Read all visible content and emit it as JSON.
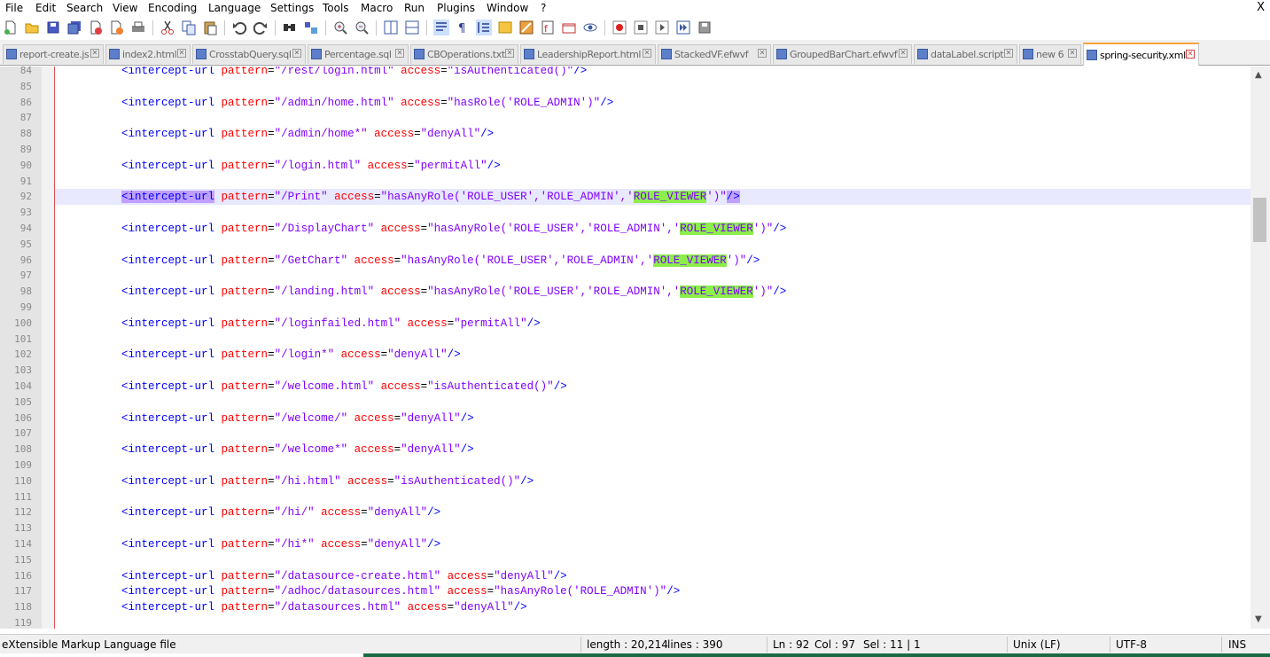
{
  "menu": [
    "File",
    "Edit",
    "Search",
    "View",
    "Encoding",
    "Language",
    "Settings",
    "Tools",
    "Macro",
    "Run",
    "Plugins",
    "Window",
    "?"
  ],
  "close_label": "X",
  "tabs": [
    {
      "label": "report-create.js"
    },
    {
      "label": "index2.html"
    },
    {
      "label": "CrosstabQuery.sql"
    },
    {
      "label": "Percentage.sql"
    },
    {
      "label": "CBOperations.txt"
    },
    {
      "label": "LeadershipReport.html"
    },
    {
      "label": "StackedVF.efwvf"
    },
    {
      "label": "GroupedBarChart.efwvf"
    },
    {
      "label": "dataLabel.script"
    },
    {
      "label": "new 6"
    },
    {
      "label": "spring-security.xml",
      "active": true
    }
  ],
  "tab_nav": {
    "left": "◂",
    "right": "▸"
  },
  "editor": {
    "line_numbers": [
      "84",
      "85",
      "86",
      "87",
      "88",
      "89",
      "90",
      "91",
      "92",
      "93",
      "94",
      "95",
      "96",
      "97",
      "98",
      "99",
      "100",
      "101",
      "102",
      "103",
      "104",
      "105",
      "106",
      "107",
      "108",
      "109",
      "110",
      "111",
      "112",
      "113",
      "114",
      "115",
      "116",
      "117",
      "118",
      "119"
    ],
    "current_line": "92",
    "lines": [
      {
        "n": "84",
        "pattern": "\"/rest/login.html\"",
        "access": "\"isAuthenticated()\"",
        "close": "/>"
      },
      {
        "n": "86",
        "pattern": "\"/admin/home.html\"",
        "access": "\"hasRole('ROLE_ADMIN')\"",
        "close": "/>"
      },
      {
        "n": "88",
        "pattern": "\"/admin/home*\"",
        "access": "\"denyAll\"",
        "close": "/>"
      },
      {
        "n": "90",
        "pattern": "\"/login.html\"",
        "access": "\"permitAll\"",
        "close": "/>"
      },
      {
        "n": "92",
        "pattern": "\"/Print\"",
        "access": "\"hasAnyRole('ROLE_USER','ROLE_ADMIN','",
        "mark": "ROLE_VIEWER",
        "access_end": "')\"",
        "close": "/>"
      },
      {
        "n": "94",
        "pattern": "\"/DisplayChart\"",
        "access": "\"hasAnyRole('ROLE_USER','ROLE_ADMIN','",
        "mark": "ROLE_VIEWER",
        "access_end": "')\"",
        "close": "/>"
      },
      {
        "n": "96",
        "pattern": "\"/GetChart\"",
        "access": "\"hasAnyRole('ROLE_USER','ROLE_ADMIN','",
        "mark": "ROLE_VIEWER",
        "access_end": "')\"",
        "close": "/>"
      },
      {
        "n": "98",
        "pattern": "\"/landing.html\"",
        "access": "\"hasAnyRole('ROLE_USER','ROLE_ADMIN','",
        "mark": "ROLE_VIEWER",
        "access_end": "')\"",
        "close": "/>"
      },
      {
        "n": "100",
        "pattern": "\"/loginfailed.html\"",
        "access": "\"permitAll\"",
        "close": "/>"
      },
      {
        "n": "102",
        "pattern": "\"/login*\"",
        "access": "\"denyAll\"",
        "close": "/>"
      },
      {
        "n": "104",
        "pattern": "\"/welcome.html\"",
        "access": "\"isAuthenticated()\"",
        "close": "/>"
      },
      {
        "n": "106",
        "pattern": "\"/welcome/\"",
        "access": "\"denyAll\"",
        "close": "/>"
      },
      {
        "n": "108",
        "pattern": "\"/welcome*\"",
        "access": "\"denyAll\"",
        "close": "/>"
      },
      {
        "n": "110",
        "pattern": "\"/hi.html\"",
        "access": "\"isAuthenticated()\"",
        "close": "/>"
      },
      {
        "n": "112",
        "pattern": "\"/hi/\"",
        "access": "\"denyAll\"",
        "close": "/>"
      },
      {
        "n": "114",
        "pattern": "\"/hi*\"",
        "access": "\"denyAll\"",
        "close": "/>"
      },
      {
        "n": "116",
        "pattern": "\"/datasource-create.html\"",
        "access": "\"denyAll\"",
        "close": "/>"
      },
      {
        "n": "117",
        "pattern": "\"/adhoc/datasources.html\"",
        "access": "\"hasAnyRole('ROLE_ADMIN')\"",
        "close": "/>"
      },
      {
        "n": "118",
        "pattern": "\"/datasources.html\"",
        "access": "\"denyAll\"",
        "close": "/>"
      }
    ],
    "tag_open": "<intercept-url",
    "attr_pattern": "pattern",
    "attr_access": "access",
    "equals": "="
  },
  "status": {
    "file_type": "eXtensible Markup Language file",
    "length": "length : 20,214",
    "lines": "lines : 390",
    "ln": "Ln : 92",
    "col": "Col : 97",
    "sel": "Sel : 11 | 1",
    "eol": "Unix (LF)",
    "encoding": "UTF-8",
    "mode": "INS"
  },
  "colors": {
    "tag": "#0000ff",
    "attr": "#ff0000",
    "value": "#8000ff",
    "highlight": "#c0a0ff",
    "mark": "#8ced4b",
    "active_tab_accent": "#f9a33a"
  },
  "icons": [
    "new-file-icon",
    "open-file-icon",
    "save-icon",
    "save-all-icon",
    "close-icon",
    "close-all-icon",
    "print-icon",
    "cut-icon",
    "copy-icon",
    "paste-icon",
    "undo-icon",
    "redo-icon",
    "find-icon",
    "replace-icon",
    "zoom-in-icon",
    "zoom-out-icon",
    "sync-vertical-icon",
    "sync-horizontal-icon",
    "word-wrap-icon",
    "show-all-chars-icon",
    "indent-guide-icon",
    "user-lang-icon",
    "doc-map-icon",
    "function-list-icon",
    "folder-workspace-icon",
    "monitor-icon",
    "record-macro-icon",
    "stop-record-icon",
    "play-macro-icon",
    "run-macro-multiple-icon",
    "save-macro-icon"
  ]
}
